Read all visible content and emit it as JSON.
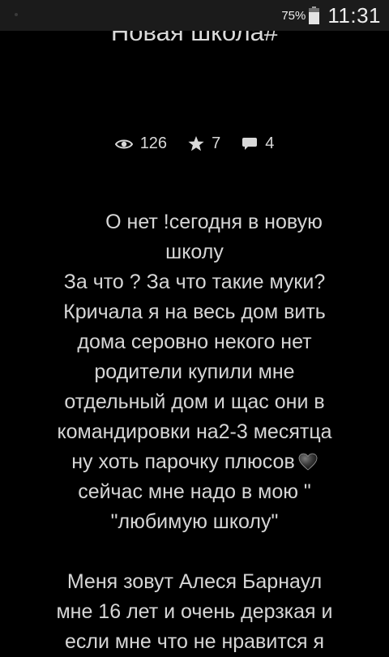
{
  "status_bar": {
    "battery_percent": "75%",
    "battery_level": 0.75,
    "time": "11:31"
  },
  "page": {
    "title": "Новая школа#"
  },
  "stats": {
    "views": "126",
    "stars": "7",
    "comments": "4"
  },
  "story": {
    "lines": [
      "О нет !сегодня в новую",
      "школу",
      "За что ? За что такие муки?",
      "Кричала я на весь дом вить",
      "дома серовно некого нет",
      "родители купили мне",
      "отдельный дом и щас они в",
      "командировки на2-3 месятца",
      "ну хоть  парочку плюсов",
      "сейчас мне надо в мою \"",
      "\"любимую школу\"",
      "Меня зовут Алеся  Барнаул",
      "мне 16 лет и очень дерзкая и",
      "если мне что не нравится я"
    ]
  },
  "colors": {
    "background": "#000000",
    "status_bar": "#1b1b1b",
    "text": "#d6d6d6"
  },
  "icons": {
    "views": "eye-icon",
    "stars": "star-icon",
    "comments": "comment-icon",
    "heart": "black-heart-emoji"
  }
}
